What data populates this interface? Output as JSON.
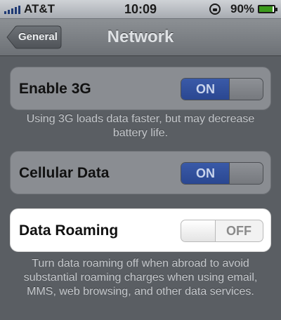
{
  "status_bar": {
    "carrier": "AT&T",
    "signal_bars": 5,
    "time": "10:09",
    "battery_percent": "90%",
    "battery_level": 0.9,
    "battery_color": "#3c9a1c"
  },
  "nav": {
    "back_label": "General",
    "title": "Network"
  },
  "settings": [
    {
      "label": "Enable 3G",
      "state": "ON",
      "footnote": "Using 3G loads data faster, but may decrease battery life."
    },
    {
      "label": "Cellular Data",
      "state": "ON"
    },
    {
      "label": "Data Roaming",
      "state": "OFF",
      "footnote": "Turn data roaming off when abroad to avoid substantial roaming charges when using email, MMS, web browsing, and other data services."
    }
  ],
  "colors": {
    "toggle_on": "#2f4f9c",
    "highlight": "#ffffff"
  },
  "icons": {
    "rotation_lock": "rotation-lock-icon",
    "battery": "battery-icon",
    "signal": "signal-strength-icon",
    "back": "back-arrow-button"
  }
}
